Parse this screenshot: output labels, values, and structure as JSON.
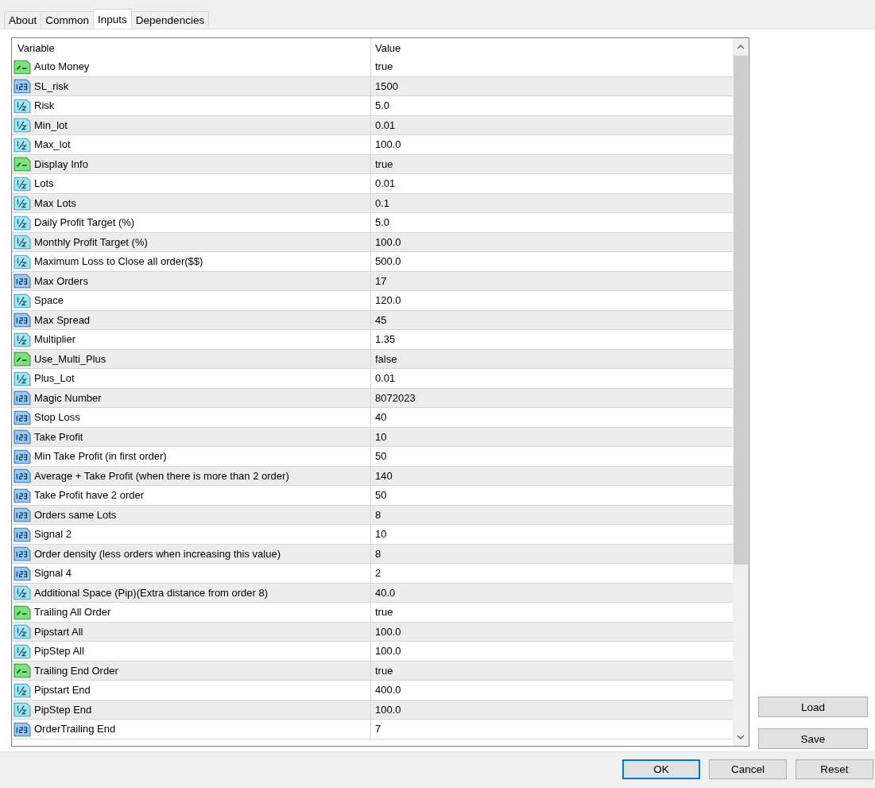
{
  "tabs": [
    {
      "label": "About",
      "selected": false
    },
    {
      "label": "Common",
      "selected": false
    },
    {
      "label": "Inputs",
      "selected": true
    },
    {
      "label": "Dependencies",
      "selected": false
    }
  ],
  "table": {
    "columns": [
      "Variable",
      "Value"
    ],
    "rows": [
      {
        "kind": "bool",
        "variable": "Auto Money",
        "value": "true"
      },
      {
        "kind": "int",
        "variable": "SL_risk",
        "value": "1500"
      },
      {
        "kind": "double",
        "variable": "Risk",
        "value": "5.0"
      },
      {
        "kind": "double",
        "variable": "Min_lot",
        "value": "0.01"
      },
      {
        "kind": "double",
        "variable": "Max_lot",
        "value": "100.0"
      },
      {
        "kind": "bool",
        "variable": "Display Info",
        "value": "true"
      },
      {
        "kind": "double",
        "variable": "Lots",
        "value": "0.01"
      },
      {
        "kind": "double",
        "variable": "Max Lots",
        "value": "0.1"
      },
      {
        "kind": "double",
        "variable": "Daily Profit Target (%)",
        "value": "5.0"
      },
      {
        "kind": "double",
        "variable": "Monthly Profit Target (%)",
        "value": "100.0"
      },
      {
        "kind": "double",
        "variable": "Maximum Loss to Close all order($$)",
        "value": "500.0"
      },
      {
        "kind": "int",
        "variable": "Max Orders",
        "value": "17"
      },
      {
        "kind": "double",
        "variable": "Space",
        "value": "120.0"
      },
      {
        "kind": "int",
        "variable": "Max Spread",
        "value": "45"
      },
      {
        "kind": "double",
        "variable": "Multiplier",
        "value": "1.35"
      },
      {
        "kind": "bool",
        "variable": "Use_Multi_Plus",
        "value": "false"
      },
      {
        "kind": "double",
        "variable": "Plus_Lot",
        "value": "0.01"
      },
      {
        "kind": "int",
        "variable": "Magic Number",
        "value": "8072023"
      },
      {
        "kind": "int",
        "variable": "Stop Loss",
        "value": "40"
      },
      {
        "kind": "int",
        "variable": "Take Profit",
        "value": "10"
      },
      {
        "kind": "int",
        "variable": "Min Take Profit (in first order)",
        "value": "50"
      },
      {
        "kind": "int",
        "variable": "Average + Take Profit (when there is more than 2 order)",
        "value": "140"
      },
      {
        "kind": "int",
        "variable": "Take Profit have 2 order",
        "value": "50"
      },
      {
        "kind": "int",
        "variable": "Orders same Lots",
        "value": "8"
      },
      {
        "kind": "int",
        "variable": "Signal 2",
        "value": "10"
      },
      {
        "kind": "int",
        "variable": "Order density (less orders when increasing this value)",
        "value": "8"
      },
      {
        "kind": "int",
        "variable": "Signal 4",
        "value": "2"
      },
      {
        "kind": "double",
        "variable": "Additional Space (Pip)(Extra distance from order 8)",
        "value": "40.0"
      },
      {
        "kind": "bool",
        "variable": "Trailing All Order",
        "value": "true"
      },
      {
        "kind": "double",
        "variable": "Pipstart All",
        "value": "100.0"
      },
      {
        "kind": "double",
        "variable": "PipStep All",
        "value": "100.0"
      },
      {
        "kind": "bool",
        "variable": "Trailing End Order",
        "value": "true"
      },
      {
        "kind": "double",
        "variable": "Pipstart End",
        "value": "400.0"
      },
      {
        "kind": "double",
        "variable": "PipStep End",
        "value": "100.0"
      },
      {
        "kind": "int",
        "variable": "OrderTrailing End",
        "value": "7"
      }
    ]
  },
  "side_buttons": [
    "Load",
    "Save"
  ],
  "buttons": [
    {
      "label": "OK",
      "selected": true
    },
    {
      "label": "Cancel",
      "selected": false
    },
    {
      "label": "Reset",
      "selected": false
    }
  ]
}
